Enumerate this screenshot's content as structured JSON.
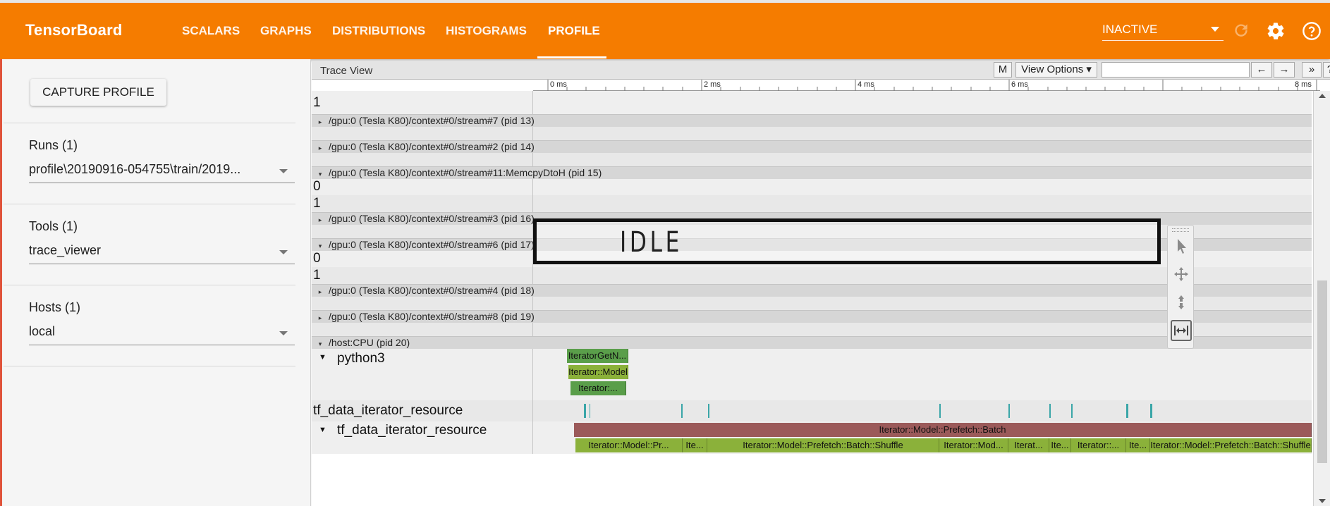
{
  "app": {
    "title": "TensorBoard"
  },
  "nav": {
    "tabs": [
      {
        "label": "SCALARS"
      },
      {
        "label": "GRAPHS"
      },
      {
        "label": "DISTRIBUTIONS"
      },
      {
        "label": "HISTOGRAMS"
      },
      {
        "label": "PROFILE",
        "active": true
      }
    ]
  },
  "toolbar": {
    "run_state": "INACTIVE",
    "icons": [
      "reload-icon",
      "gear-icon",
      "help-icon"
    ]
  },
  "sidebar": {
    "capture_label": "CAPTURE PROFILE",
    "runs": {
      "label": "Runs (1)",
      "value": "profile\\20190916-054755\\train/2019..."
    },
    "tools": {
      "label": "Tools (1)",
      "value": "trace_viewer"
    },
    "hosts": {
      "label": "Hosts (1)",
      "value": "local"
    }
  },
  "trace": {
    "title": "Trace View",
    "buttons": {
      "m": "M",
      "view_options": "View Options ▾",
      "prev": "←",
      "next": "→",
      "more": "»",
      "help": "?"
    },
    "ticks": [
      "0 ms",
      "2 ms",
      "4 ms",
      "6 ms",
      "8 ms"
    ],
    "groups": [
      {
        "label": "/gpu:0 (Tesla K80)/context#0/stream#7 (pid 13)",
        "expanded": false
      },
      {
        "label": "/gpu:0 (Tesla K80)/context#0/stream#2 (pid 14)",
        "expanded": false
      },
      {
        "label": "/gpu:0 (Tesla K80)/context#0/stream#11:MemcpyDtoH (pid 15)",
        "expanded": true
      },
      {
        "label": "/gpu:0 (Tesla K80)/context#0/stream#3 (pid 16)",
        "expanded": false
      },
      {
        "label": "/gpu:0 (Tesla K80)/context#0/stream#6 (pid 17)",
        "expanded": true
      },
      {
        "label": "/gpu:0 (Tesla K80)/context#0/stream#4 (pid 18)",
        "expanded": false
      },
      {
        "label": "/gpu:0 (Tesla K80)/context#0/stream#8 (pid 19)",
        "expanded": false
      },
      {
        "label": "/host:CPU (pid 20)",
        "expanded": true
      }
    ],
    "row_labels": {
      "top": "1",
      "s11_0": "0",
      "s11_1": "1",
      "s6_0": "0",
      "s6_1": "1",
      "python3": "python3",
      "tf_res_1": "tf_data_iterator_resource",
      "tf_res_2": "tf_data_iterator_resource"
    },
    "python_slices": [
      "IteratorGetN...",
      "Iterator::Model",
      "Iterator:..."
    ],
    "batch_slice": "Iterator::Model::Prefetch::Batch",
    "shuffle_slices": [
      "Iterator::Model::Pr...",
      "Ite...",
      "Iterator::Model::Prefetch::Batch::Shuffle",
      "Iterator::Mod...",
      "Iterat...",
      "Ite...",
      "Iterator::...",
      "Ite...",
      "Iterator::Model::Prefetch::Batch::Shuffle"
    ],
    "overlay_text": "IDLE",
    "colors": {
      "green": "#5a9e4a",
      "olive": "#8bb13a",
      "batch": "#9b5a5a",
      "mark": "#3aa6a8"
    }
  }
}
